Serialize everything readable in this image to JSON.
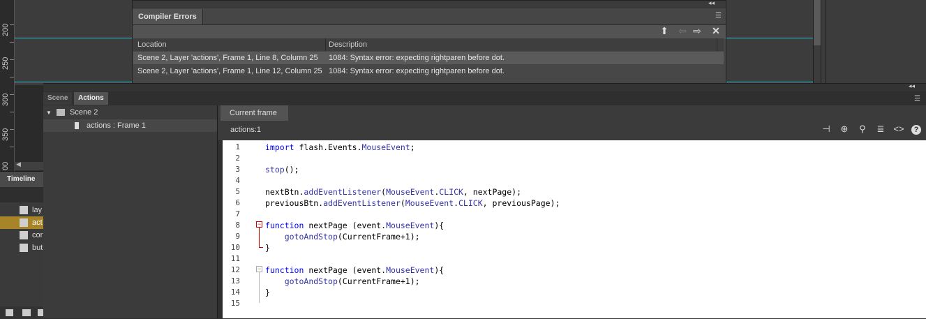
{
  "stage": {
    "ruler_labels": [
      "200",
      "250",
      "300",
      "350",
      "00"
    ]
  },
  "compiler_errors": {
    "tab_label": "Compiler Errors",
    "columns": [
      "Location",
      "Description"
    ],
    "rows": [
      {
        "location": "Scene 2, Layer 'actions', Frame 1, Line 8, Column 25",
        "description": "1084: Syntax error: expecting rightparen before dot."
      },
      {
        "location": "Scene 2, Layer 'actions', Frame 1, Line 12, Column 25",
        "description": "1084: Syntax error: expecting rightparen before dot."
      }
    ]
  },
  "panel_tabs": {
    "scene": "Scene",
    "actions": "Actions"
  },
  "tree": {
    "scene": "Scene 2",
    "frame": "actions : Frame 1"
  },
  "timeline": {
    "tab_label": "Timeline",
    "layers": [
      "lay",
      "act",
      "cor",
      "but"
    ]
  },
  "editor": {
    "tab_label": "Current frame",
    "script_label": "actions:1",
    "line_numbers": [
      "1",
      "2",
      "3",
      "4",
      "5",
      "6",
      "7",
      "8",
      "9",
      "10",
      "11",
      "12",
      "13",
      "14",
      "15"
    ]
  }
}
